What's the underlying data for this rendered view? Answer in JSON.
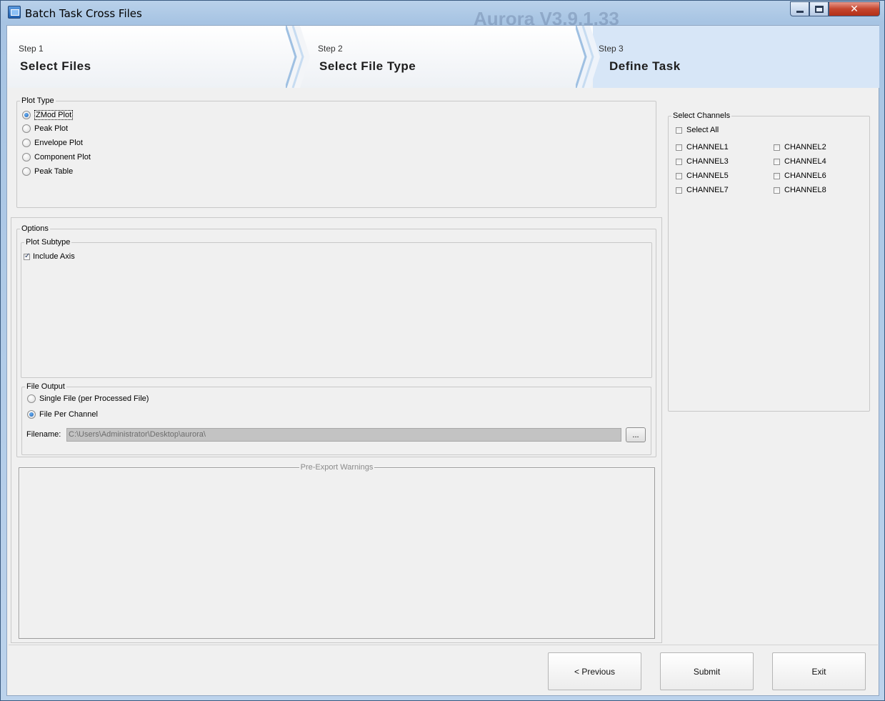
{
  "window": {
    "title": "Batch Task Cross Files",
    "background_title": "Aurora V3.9.1.33"
  },
  "steps": [
    {
      "small": "Step 1",
      "big": "Select Files"
    },
    {
      "small": "Step 2",
      "big": "Select File Type"
    },
    {
      "small": "Step 3",
      "big": "Define Task"
    }
  ],
  "plot_type": {
    "legend": "Plot Type",
    "options": [
      "ZMod Plot",
      "Peak Plot",
      "Envelope Plot",
      "Component Plot",
      "Peak Table"
    ],
    "selected": "ZMod Plot"
  },
  "options": {
    "legend": "Options",
    "plot_subtype": {
      "legend": "Plot Subtype",
      "include_axis_label": "Include Axis",
      "include_axis_checked": true
    },
    "file_output": {
      "legend": "File Output",
      "single_file_label": "Single File (per Processed File)",
      "file_per_channel_label": "File Per Channel",
      "selected": "File Per Channel",
      "filename_label": "Filename:",
      "filename_value": "C:\\Users\\Administrator\\Desktop\\aurora\\",
      "browse_label": "..."
    },
    "warnings_legend": "Pre-Export Warnings"
  },
  "channels": {
    "legend": "Select Channels",
    "select_all_label": "Select All",
    "items": [
      "CHANNEL1",
      "CHANNEL2",
      "CHANNEL3",
      "CHANNEL4",
      "CHANNEL5",
      "CHANNEL6",
      "CHANNEL7",
      "CHANNEL8"
    ]
  },
  "buttons": {
    "previous": "< Previous",
    "submit": "Submit",
    "exit": "Exit"
  },
  "colors": {
    "active_step_bg": "#d7e6f7",
    "close_button": "#c5462e"
  }
}
